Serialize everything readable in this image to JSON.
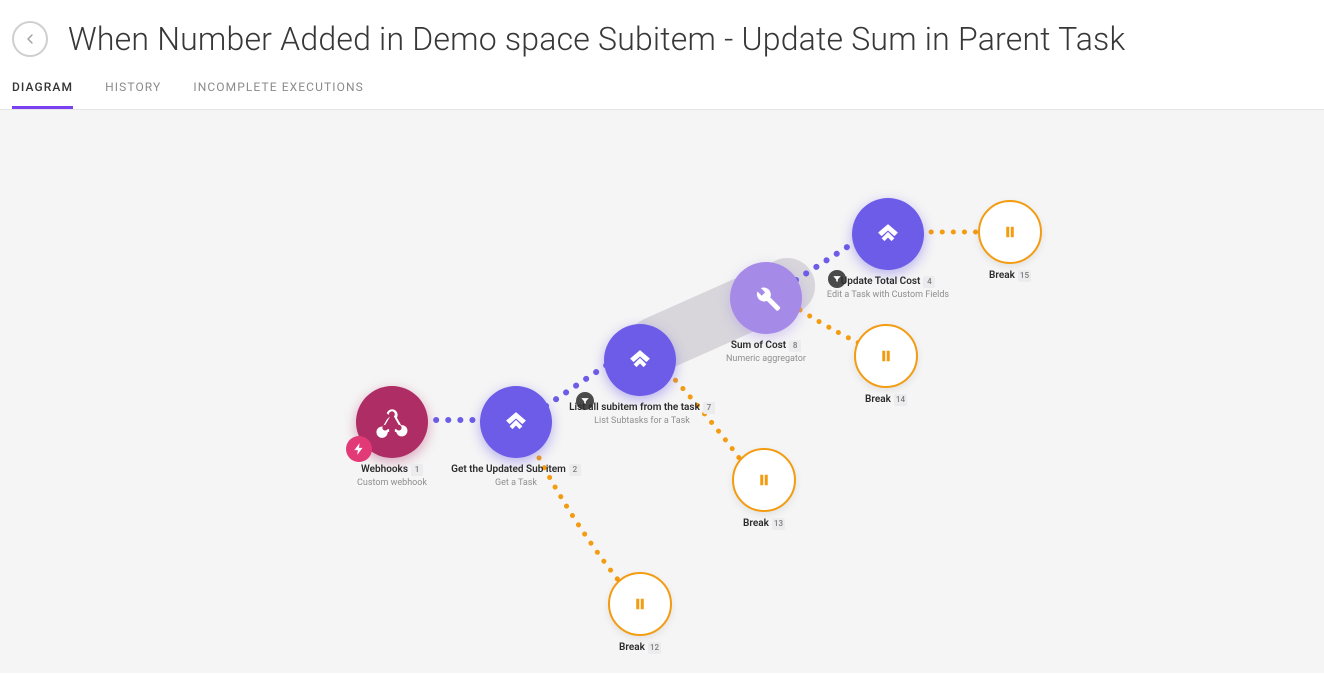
{
  "header": {
    "title": "When Number Added in Demo space Subitem - Update Sum in Parent Task"
  },
  "tabs": {
    "diagram": "DIAGRAM",
    "history": "HISTORY",
    "incomplete": "INCOMPLETE EXECUTIONS"
  },
  "nodes": {
    "webhooks": {
      "title": "Webhooks",
      "subtitle": "Custom webhook",
      "count": "1"
    },
    "get_sub": {
      "title": "Get the Updated Sub item",
      "subtitle": "Get a Task",
      "count": "2"
    },
    "list_sub": {
      "title": "List all subitem from the task",
      "subtitle": "List Subtasks for a Task",
      "count": "7"
    },
    "sum": {
      "title": "Sum of Cost",
      "subtitle": "Numeric aggregator",
      "count": "8"
    },
    "update": {
      "title": "Update Total Cost",
      "subtitle": "Edit a Task with Custom Fields",
      "count": "4"
    },
    "break_top": {
      "title": "Break",
      "count": "15"
    },
    "break_mid": {
      "title": "Break",
      "count": "14"
    },
    "break_low": {
      "title": "Break",
      "count": "13"
    },
    "break_bot": {
      "title": "Break",
      "count": "12"
    }
  },
  "colors": {
    "accent": "#7b40f2",
    "node_purple": "#6c5ce7",
    "node_lightpurple": "#a58ae8",
    "node_maroon": "#ad2d64",
    "break_orange": "#f39c12"
  }
}
